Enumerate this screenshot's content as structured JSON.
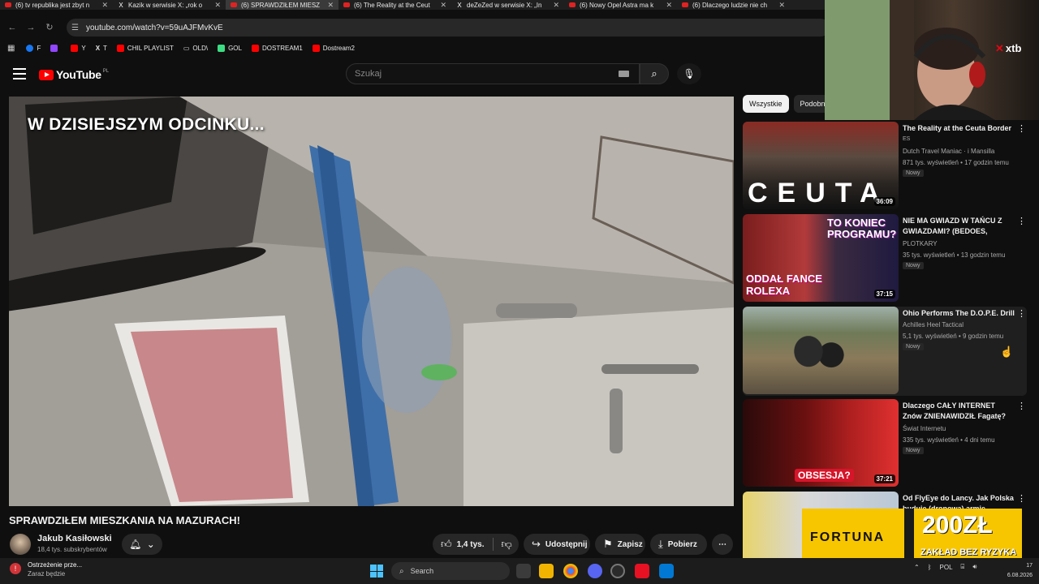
{
  "browser": {
    "tabs": [
      {
        "title": "(6) tv republika jest zbyt n",
        "icon": "youtube-icon",
        "active": false
      },
      {
        "title": "Kazik w serwisie X: „rok o",
        "icon": "x-icon",
        "active": false
      },
      {
        "title": "(6) SPRAWDZIŁEM MIESZ",
        "icon": "youtube-icon",
        "active": true
      },
      {
        "title": "(6) The Reality at the Ceut",
        "icon": "youtube-icon",
        "active": false
      },
      {
        "title": "deZeZed w serwisie X: „In",
        "icon": "x-icon",
        "active": false
      },
      {
        "title": "(6) Nowy Opel Astra ma k",
        "icon": "youtube-icon",
        "active": false
      },
      {
        "title": "(6) Dlaczego ludzie nie ch",
        "icon": "youtube-icon",
        "active": false
      }
    ],
    "url": "youtube.com/watch?v=59uAJFMvKvE",
    "bookmarks": [
      {
        "label": "F",
        "color": "#1877f2"
      },
      {
        "label": "",
        "color": "#9146ff"
      },
      {
        "label": "Y",
        "color": "#ff0000"
      },
      {
        "label": "T",
        "color": "#ffffff",
        "icon": "x-icon"
      },
      {
        "label": "CHIL PLAYLIST",
        "color": "#ff0000"
      },
      {
        "label": "OLD\\",
        "color": "#cccccc",
        "icon": "folder-icon"
      },
      {
        "label": "GOL",
        "color": "#3ddc84"
      },
      {
        "label": "DOSTREAM1",
        "color": "#ff0000"
      },
      {
        "label": "Dostream2",
        "color": "#ff0000"
      }
    ]
  },
  "youtube": {
    "logo_text": "YouTube",
    "region": "PL",
    "search_placeholder": "Szukaj"
  },
  "video": {
    "overlay_text": "W DZISIEJSZYM ODCINKU...",
    "title": "SPRAWDZIŁEM MIESZKANIA NA MAZURACH!",
    "channel": "Jakub Kasiłowski",
    "subscribers": "18,4 tys. subskrybentów",
    "likes": "1,4 tys.",
    "share_label": "Udostępnij",
    "save_label": "Zapisz",
    "download_label": "Pobierz"
  },
  "sidebar": {
    "chips": [
      "Wszystkie",
      "Podobne"
    ],
    "recommendations": [
      {
        "title": "The Reality at the Ceuta Border",
        "sub": "ES",
        "channel": "Dutch Travel Maniac · i Mansilla",
        "meta": "871 tys. wyświetleń • 17 godzin temu",
        "badge": "Nowy",
        "duration": "36:09",
        "thumb_text": "CEUTA"
      },
      {
        "title": "NIE MA GWIAZD W TAŃCU Z GWIAZDAMI? (BEDOES, JULIA...",
        "channel": "PLOTKARY",
        "meta": "35 tys. wyświetleń • 13 godzin temu",
        "badge": "Nowy",
        "duration": "37:15",
        "thumb_text_top": "TO KONIEC PROGRAMU?",
        "thumb_text_bottom": "ODDAŁ FANCE ROLEXA"
      },
      {
        "title": "Ohio Performs The D.O.P.E. Drill",
        "channel": "Achilles Heel Tactical",
        "meta": "5,1 tys. wyświetleń • 9 godzin temu",
        "badge": "Nowy",
        "duration": ""
      },
      {
        "title": "Dlaczego CAŁY INTERNET Znów ZNIENAWIDZIŁ Fagatę?",
        "channel": "Świat Internetu",
        "meta": "335 tys. wyświetleń • 4 dni temu",
        "badge": "Nowy",
        "duration": "37:21",
        "thumb_text": "OBSESJA?"
      },
      {
        "title": "Od FlyEye do Lancy. Jak Polska buduje (dronową) armię",
        "channel": "",
        "meta": "",
        "badge": "",
        "duration": ""
      }
    ]
  },
  "stream_overlay": {
    "sponsor": "xtb",
    "ad_brand": "FORTUNA",
    "ad_offer": "200ZŁ",
    "ad_sub": "ZAKŁAD BEZ RYZYKA"
  },
  "taskbar": {
    "notification_title": "Ostrzeżenie prze...",
    "notification_sub": "Zaraz będzie",
    "search_placeholder": "Search",
    "language": "POL",
    "time": "17",
    "date": "6.08.2026"
  }
}
